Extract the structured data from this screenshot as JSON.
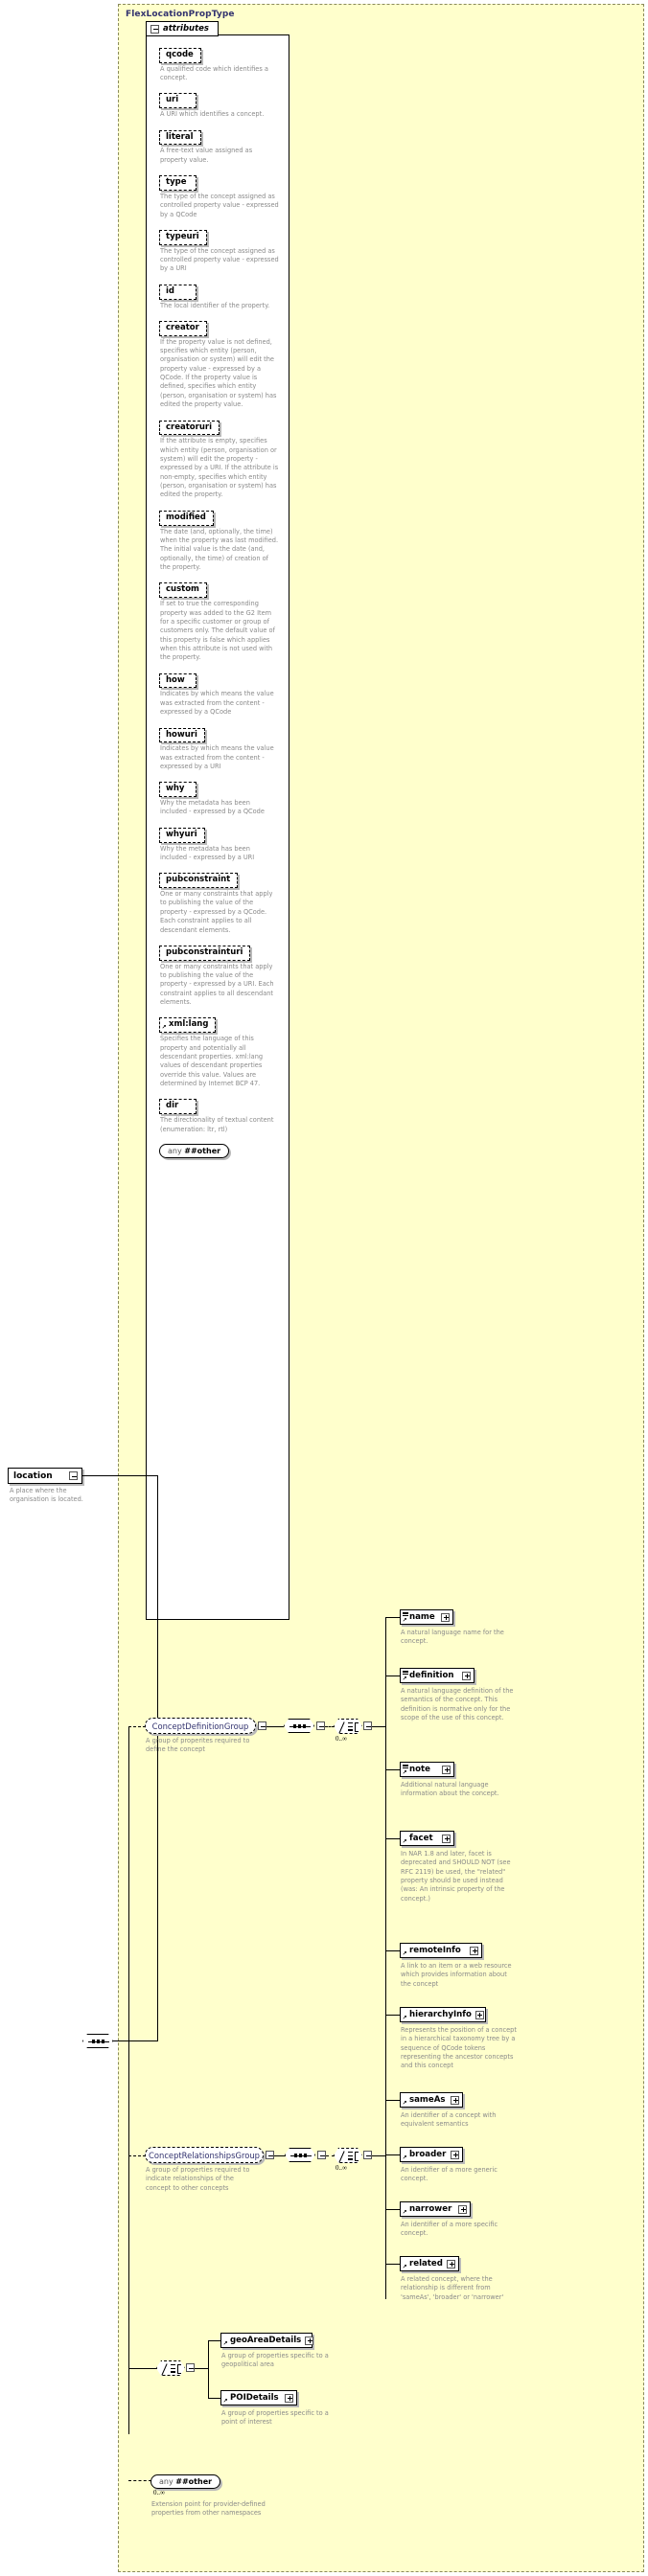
{
  "diagram": {
    "type_name": "FlexLocationPropType",
    "attributes_label": "attributes",
    "colors": {
      "background": "#ffffcc",
      "type_title": "#33336f",
      "description": "#8a8a8a"
    }
  },
  "root_element": {
    "label": "location",
    "description": "A place where the organisation is located."
  },
  "attributes": [
    {
      "name": "qcode",
      "description": "A qualified code which identifies a concept."
    },
    {
      "name": "uri",
      "description": "A URI which identifies a concept."
    },
    {
      "name": "literal",
      "description": "A free-text value assigned as property value."
    },
    {
      "name": "type",
      "description": "The type of the concept assigned as controlled property value - expressed by a QCode"
    },
    {
      "name": "typeuri",
      "description": "The type of the concept assigned as controlled property value - expressed by a URI"
    },
    {
      "name": "id",
      "description": "The local identifier of the property."
    },
    {
      "name": "creator",
      "description": "If the property value is not defined, specifies which entity (person, organisation or system) will edit the property value - expressed by a QCode. If the property value is defined, specifies which entity (person, organisation or system) has edited the property value."
    },
    {
      "name": "creatoruri",
      "description": "If the attribute is empty, specifies which entity (person, organisation or system) will edit the property - expressed by a URI. If the attribute is non-empty, specifies which entity (person, organisation or system) has edited the property."
    },
    {
      "name": "modified",
      "description": "The date (and, optionally, the time) when the property was last modified. The initial value is the date (and, optionally, the time) of creation of the property."
    },
    {
      "name": "custom",
      "description": "If set to true the corresponding property was added to the G2 Item for a specific customer or group of customers only. The default value of this property is false which applies when this attribute is not used with the property."
    },
    {
      "name": "how",
      "description": "Indicates by which means the value was extracted from the content - expressed by a QCode"
    },
    {
      "name": "howuri",
      "description": "Indicates by which means the value was extracted from the content - expressed by a URI"
    },
    {
      "name": "why",
      "description": "Why the metadata has been included - expressed by a QCode"
    },
    {
      "name": "whyuri",
      "description": "Why the metadata has been included - expressed by a URI"
    },
    {
      "name": "pubconstraint",
      "description": "One or many constraints that apply to publishing the value of the property - expressed by a QCode. Each constraint applies to all descendant elements."
    },
    {
      "name": "pubconstrainturi",
      "description": "One or many constraints that apply to publishing the value of the property - expressed by a URI. Each constraint applies to all descendant elements."
    },
    {
      "name": "xml:lang",
      "has_arrow": true,
      "description": "Specifies the language of this property and potentially all descendant properties. xml:lang values of descendant properties override this value. Values are determined by Internet BCP 47."
    },
    {
      "name": "dir",
      "description": "The directionality of textual content (enumeration: ltr, rtl)"
    }
  ],
  "attributes_any": {
    "prefix": "any",
    "label": "##other"
  },
  "groups": {
    "concept_definition": {
      "label": "ConceptDefinitionGroup",
      "description": "A group of properites required to define the concept",
      "cardinality": "0..∞",
      "members": [
        {
          "name": "name",
          "description": "A natural language name for the concept."
        },
        {
          "name": "definition",
          "description": "A natural language definition of the semantics of the concept. This definition is normative only for the scope of the use of this concept."
        },
        {
          "name": "note",
          "description": "Additional natural language information about the concept."
        },
        {
          "name": "facet",
          "description": "In NAR 1.8 and later, facet is deprecated and SHOULD NOT (see RFC 2119) be used, the \"related\" property should be used instead (was: An intrinsic property of the concept.)"
        },
        {
          "name": "remoteInfo",
          "description": "A link to an item or a web resource which provides information about the concept"
        },
        {
          "name": "hierarchyInfo",
          "description": "Represents the position of a concept in a hierarchical taxonomy tree by a sequence of QCode tokens representing the ancestor concepts and this concept"
        }
      ]
    },
    "concept_relationships": {
      "label": "ConceptRelationshipsGroup",
      "description": "A group of properties required to indicate relationships of the concept to other concepts",
      "cardinality": "0..∞",
      "members": [
        {
          "name": "sameAs",
          "description": "An identifier of a concept with equivalent semantics"
        },
        {
          "name": "broader",
          "description": "An identifier of a more generic concept."
        },
        {
          "name": "narrower",
          "description": "An identifier of a more specific concept."
        },
        {
          "name": "related",
          "description": "A related concept, where the relationship is different from 'sameAs', 'broader' or 'narrower'"
        }
      ]
    },
    "details_choice": {
      "members": [
        {
          "name": "geoAreaDetails",
          "description": "A group of properties specific to a geopolitical area"
        },
        {
          "name": "POIDetails",
          "description": "A group of properties specific to a point of interest"
        }
      ]
    }
  },
  "content_any": {
    "prefix": "any",
    "label": "##other",
    "cardinality": "0..∞",
    "description": "Extension point for provider-defined properties from other namespaces"
  }
}
